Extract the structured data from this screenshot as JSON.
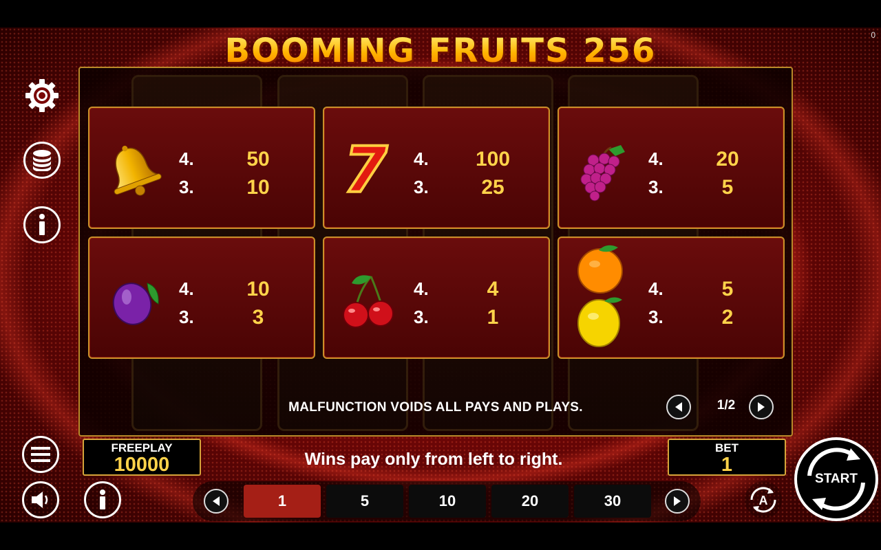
{
  "game": {
    "title": "BOOMING FRUITS 256",
    "corner_value": "0"
  },
  "paytable": {
    "symbols": [
      {
        "icon": "bell-icon",
        "pays": [
          {
            "count": "4.",
            "value": "50"
          },
          {
            "count": "3.",
            "value": "10"
          }
        ]
      },
      {
        "icon": "seven-icon",
        "pays": [
          {
            "count": "4.",
            "value": "100"
          },
          {
            "count": "3.",
            "value": "25"
          }
        ],
        "seven_text": "7"
      },
      {
        "icon": "grapes-icon",
        "pays": [
          {
            "count": "4.",
            "value": "20"
          },
          {
            "count": "3.",
            "value": "5"
          }
        ]
      },
      {
        "icon": "plum-icon",
        "pays": [
          {
            "count": "4.",
            "value": "10"
          },
          {
            "count": "3.",
            "value": "3"
          }
        ]
      },
      {
        "icon": "cherries-icon",
        "pays": [
          {
            "count": "4.",
            "value": "4"
          },
          {
            "count": "3.",
            "value": "1"
          }
        ]
      },
      {
        "icon": "orange-lemon-icon",
        "pays": [
          {
            "count": "4.",
            "value": "5"
          },
          {
            "count": "3.",
            "value": "2"
          }
        ]
      }
    ],
    "disclaimer": "MALFUNCTION VOIDS ALL PAYS AND PLAYS.",
    "page_indicator": "1/2"
  },
  "balance": {
    "label": "FREEPLAY",
    "value": "10000"
  },
  "bet": {
    "label": "BET",
    "value": "1"
  },
  "message": "Wins pay only from left to right.",
  "bet_options": [
    "1",
    "5",
    "10",
    "20",
    "30"
  ],
  "selected_bet": "1",
  "start_label": "START",
  "colors": {
    "accent_gold": "#ffd34a",
    "card_border": "#c9902a",
    "active_chip": "#a51f16"
  }
}
